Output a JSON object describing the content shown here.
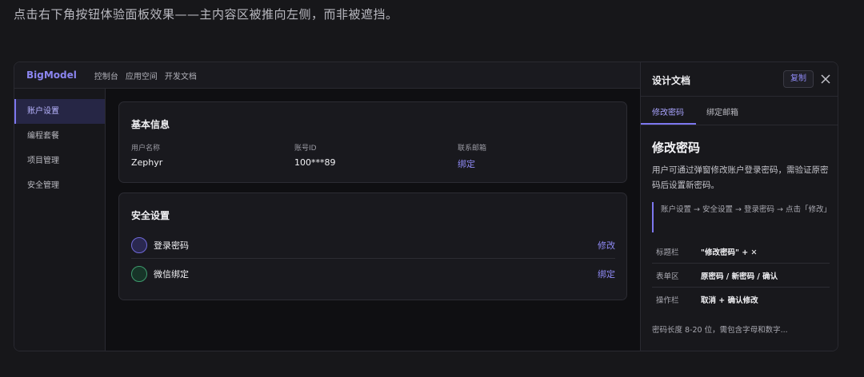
{
  "caption": "点击右下角按钮体验面板效果——主内容区被推向左侧，而非被遮挡。",
  "topnav": {
    "brand": "BigModel",
    "links": [
      "控制台",
      "应用空间",
      "开发文档"
    ]
  },
  "sidebar": {
    "items": [
      {
        "label": "账户设置",
        "active": true
      },
      {
        "label": "编程套餐"
      },
      {
        "label": "项目管理"
      },
      {
        "label": "安全管理"
      }
    ]
  },
  "basic_info": {
    "title": "基本信息",
    "fields": [
      {
        "label": "用户名称",
        "value": "Zephyr"
      },
      {
        "label": "账号ID",
        "value": "100***89"
      },
      {
        "label": "联系邮箱",
        "value": "绑定"
      }
    ]
  },
  "security": {
    "title": "安全设置",
    "rows": [
      {
        "label": "登录密码",
        "action": "修改"
      },
      {
        "label": "微信绑定",
        "action": "绑定"
      }
    ]
  },
  "panel": {
    "title": "设计文档",
    "copy_label": "复制",
    "tabs": [
      "修改密码",
      "绑定邮箱"
    ],
    "heading": "修改密码",
    "description": "用户可通过弹窗修改账户登录密码，需验证原密码后设置新密码。",
    "path": "账户设置 → 安全设置 → 登录密码 → 点击「修改」",
    "table": [
      {
        "key": "标题栏",
        "value": "\"修改密码\" + ✕"
      },
      {
        "key": "表单区",
        "value": "原密码 / 新密码 / 确认"
      },
      {
        "key": "操作栏",
        "value": "取消 + 确认修改"
      }
    ],
    "footnote": "密码长度 8-20 位，需包含字母和数字..."
  },
  "colors": {
    "accent": "#7d77ef",
    "link": "#8f8af5",
    "background": "#17171a"
  }
}
